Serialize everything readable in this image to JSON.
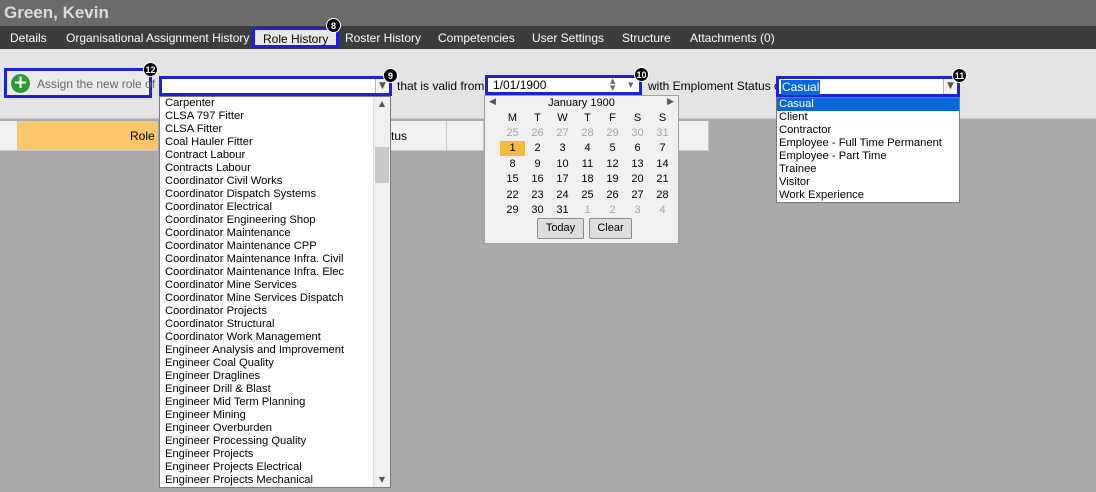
{
  "title": "Green, Kevin",
  "tabs": [
    "Details",
    "Organisational Assignment History",
    "Role History",
    "Roster History",
    "Competencies",
    "User Settings",
    "Structure",
    "Attachments (0)"
  ],
  "assign": {
    "label": "Assign the new role of"
  },
  "role_combo": {
    "value": ""
  },
  "valid_from_label": "that is valid from",
  "date_field": {
    "value": "1/01/1900"
  },
  "status_label": "with Emploment Status of",
  "status_combo": {
    "value": "Casual"
  },
  "badges": {
    "b8": "8",
    "b9": "9",
    "b10": "10",
    "b11": "11",
    "b12": "12"
  },
  "grid_headers": {
    "role": "Role",
    "status": "tus"
  },
  "role_options": [
    "Carpenter",
    "CLSA 797 Fitter",
    "CLSA Fitter",
    "Coal Hauler Fitter",
    "Contract Labour",
    "Contracts Labour",
    "Coordinator Civil Works",
    "Coordinator Dispatch Systems",
    "Coordinator Electrical",
    "Coordinator Engineering Shop",
    "Coordinator Maintenance",
    "Coordinator Maintenance CPP",
    "Coordinator Maintenance Infra. Civil",
    "Coordinator Maintenance Infra. Elec",
    "Coordinator Mine Services",
    "Coordinator Mine Services Dispatch",
    "Coordinator Projects",
    "Coordinator Structural",
    "Coordinator Work Management",
    "Engineer Analysis and Improvement",
    "Engineer Coal Quality",
    "Engineer Draglines",
    "Engineer Drill & Blast",
    "Engineer Mid Term Planning",
    "Engineer Mining",
    "Engineer Overburden",
    "Engineer Processing Quality",
    "Engineer Projects",
    "Engineer Projects Electrical",
    "Engineer Projects Mechanical"
  ],
  "calendar": {
    "month_label": "January 1900",
    "weekdays": [
      "M",
      "T",
      "W",
      "T",
      "F",
      "S",
      "S"
    ],
    "weeks": [
      [
        {
          "d": "25",
          "o": true
        },
        {
          "d": "26",
          "o": true
        },
        {
          "d": "27",
          "o": true
        },
        {
          "d": "28",
          "o": true
        },
        {
          "d": "29",
          "o": true
        },
        {
          "d": "30",
          "o": true
        },
        {
          "d": "31",
          "o": true
        }
      ],
      [
        {
          "d": "1",
          "sel": true
        },
        {
          "d": "2"
        },
        {
          "d": "3"
        },
        {
          "d": "4"
        },
        {
          "d": "5"
        },
        {
          "d": "6"
        },
        {
          "d": "7"
        }
      ],
      [
        {
          "d": "8"
        },
        {
          "d": "9"
        },
        {
          "d": "10"
        },
        {
          "d": "11"
        },
        {
          "d": "12"
        },
        {
          "d": "13"
        },
        {
          "d": "14"
        }
      ],
      [
        {
          "d": "15"
        },
        {
          "d": "16"
        },
        {
          "d": "17"
        },
        {
          "d": "18"
        },
        {
          "d": "19"
        },
        {
          "d": "20"
        },
        {
          "d": "21"
        }
      ],
      [
        {
          "d": "22"
        },
        {
          "d": "23"
        },
        {
          "d": "24"
        },
        {
          "d": "25"
        },
        {
          "d": "26"
        },
        {
          "d": "27"
        },
        {
          "d": "28"
        }
      ],
      [
        {
          "d": "29"
        },
        {
          "d": "30"
        },
        {
          "d": "31"
        },
        {
          "d": "1",
          "o": true
        },
        {
          "d": "2",
          "o": true
        },
        {
          "d": "3",
          "o": true
        },
        {
          "d": "4",
          "o": true
        }
      ]
    ],
    "today_label": "Today",
    "clear_label": "Clear"
  },
  "status_options": [
    "Casual",
    "Client",
    "Contractor",
    "Employee - Full Time Permanent",
    "Employee - Part Time",
    "Trainee",
    "Visitor",
    "Work Experience"
  ],
  "colors": {
    "highlight": "#1e22d6",
    "selected": "#0a68d6",
    "today": "#f7b93f",
    "header": "#fcc76a"
  }
}
